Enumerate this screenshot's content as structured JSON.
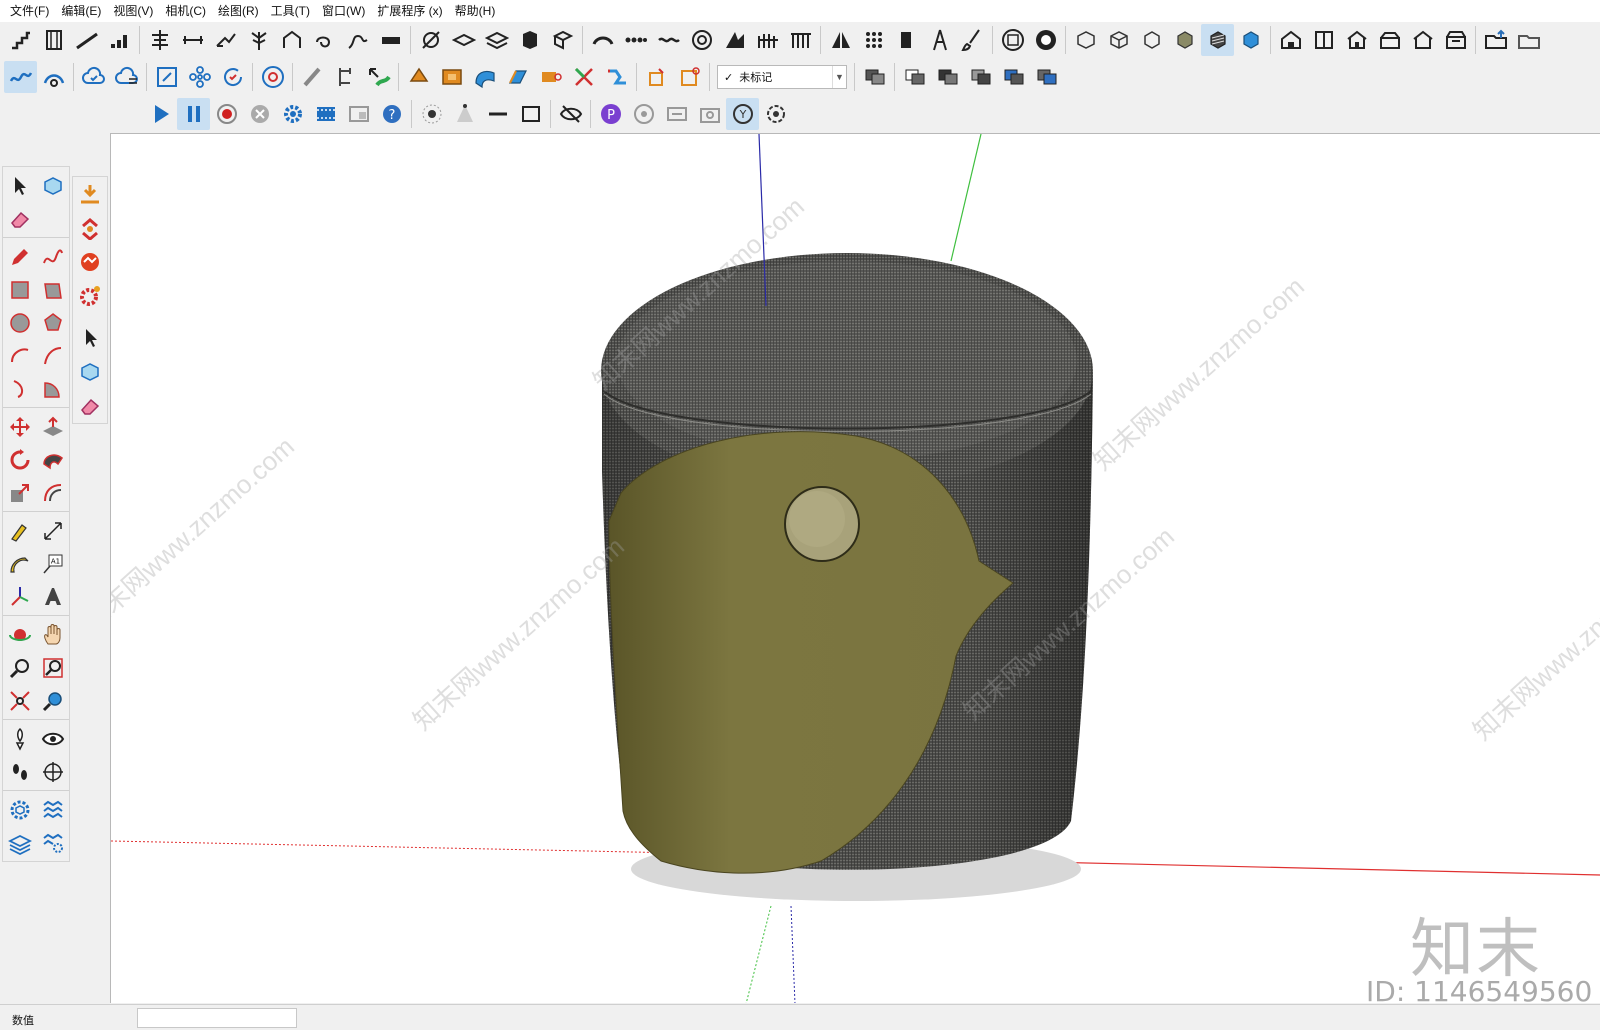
{
  "menu": [
    "文件(F)",
    "编辑(E)",
    "视图(V)",
    "相机(C)",
    "绘图(R)",
    "工具(T)",
    "窗口(W)",
    "扩展程序 (x)",
    "帮助(H)"
  ],
  "tag_dropdown": {
    "check": "✓",
    "value": "未标记"
  },
  "status": {
    "label": "数值",
    "value": ""
  },
  "watermark": {
    "logo": "知末",
    "id": "ID: 1146549560",
    "site": "知末网www.znzmo.com"
  },
  "colors": {
    "cushion_fabric": "#5a5a58",
    "bird_olive": "#7a7440",
    "bird_eye": "#a8a27a",
    "axis_red": "#e03030",
    "axis_green": "#3fbf3f",
    "axis_blue": "#2a2aa8",
    "active_button": "#c9dff2"
  }
}
